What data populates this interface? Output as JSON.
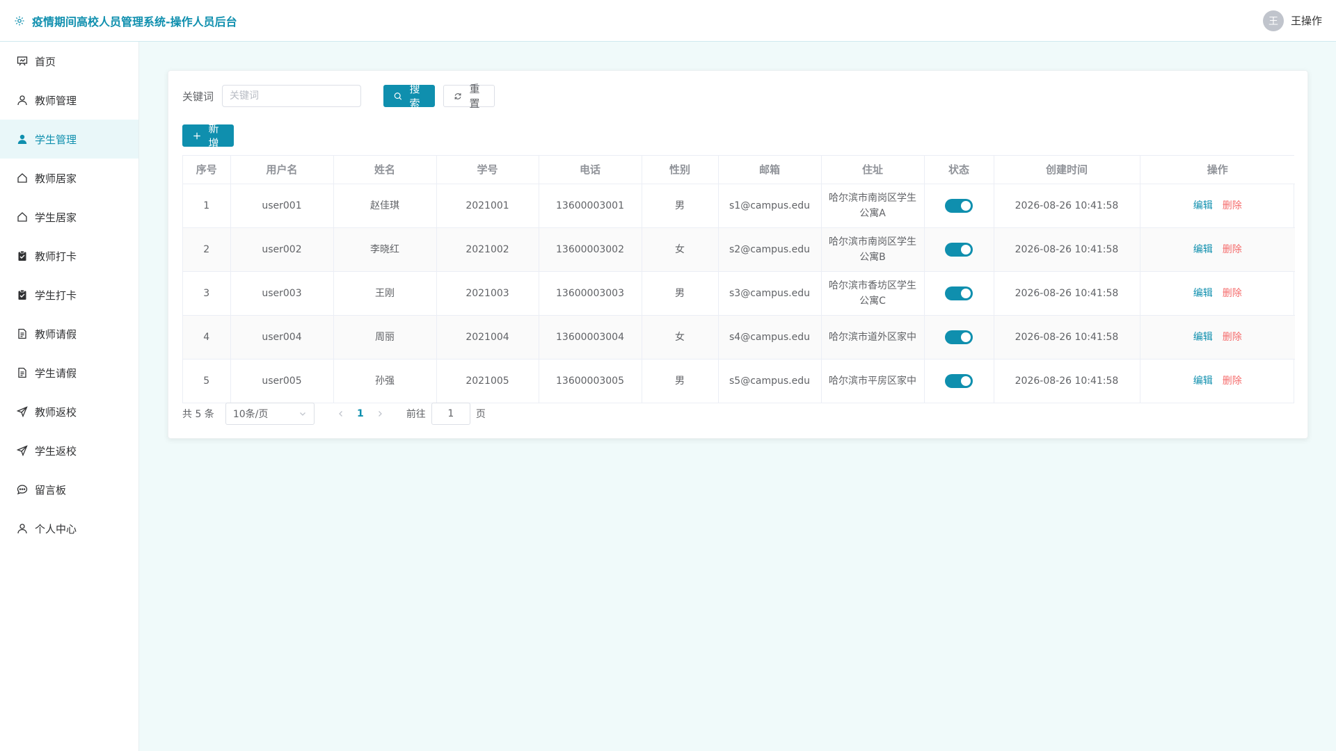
{
  "header": {
    "title": "疫情期间高校人员管理系统-操作人员后台",
    "avatar_text": "王",
    "user_name": "王操作"
  },
  "sidebar": {
    "items": [
      {
        "label": "首页",
        "icon": "dashboard-icon"
      },
      {
        "label": "教师管理",
        "icon": "user-icon"
      },
      {
        "label": "学生管理",
        "icon": "user-filled-icon",
        "active": true
      },
      {
        "label": "教师居家",
        "icon": "house-icon"
      },
      {
        "label": "学生居家",
        "icon": "house-icon"
      },
      {
        "label": "教师打卡",
        "icon": "checklist-icon"
      },
      {
        "label": "学生打卡",
        "icon": "checklist-icon"
      },
      {
        "label": "教师请假",
        "icon": "document-icon"
      },
      {
        "label": "学生请假",
        "icon": "document-icon"
      },
      {
        "label": "教师返校",
        "icon": "send-icon"
      },
      {
        "label": "学生返校",
        "icon": "send-icon"
      },
      {
        "label": "留言板",
        "icon": "chat-icon"
      },
      {
        "label": "个人中心",
        "icon": "user-icon"
      }
    ]
  },
  "search": {
    "label": "关键词",
    "placeholder": "关键词",
    "search_button": "搜索",
    "reset_button": "重置"
  },
  "toolbar": {
    "add_button": "新增"
  },
  "table": {
    "columns": [
      "序号",
      "用户名",
      "姓名",
      "学号",
      "电话",
      "性别",
      "邮箱",
      "住址",
      "状态",
      "创建时间",
      "操作"
    ],
    "rows": [
      {
        "index": "1",
        "username": "user001",
        "name": "赵佳琪",
        "student_id": "2021001",
        "phone": "13600003001",
        "gender": "男",
        "email": "s1@campus.edu",
        "address": "哈尔滨市南岗区学生公寓A",
        "status": true,
        "created": "2026-08-26 10:41:58"
      },
      {
        "index": "2",
        "username": "user002",
        "name": "李晓红",
        "student_id": "2021002",
        "phone": "13600003002",
        "gender": "女",
        "email": "s2@campus.edu",
        "address": "哈尔滨市南岗区学生公寓B",
        "status": true,
        "created": "2026-08-26 10:41:58"
      },
      {
        "index": "3",
        "username": "user003",
        "name": "王刚",
        "student_id": "2021003",
        "phone": "13600003003",
        "gender": "男",
        "email": "s3@campus.edu",
        "address": "哈尔滨市香坊区学生公寓C",
        "status": true,
        "created": "2026-08-26 10:41:58"
      },
      {
        "index": "4",
        "username": "user004",
        "name": "周丽",
        "student_id": "2021004",
        "phone": "13600003004",
        "gender": "女",
        "email": "s4@campus.edu",
        "address": "哈尔滨市道外区家中",
        "status": true,
        "created": "2026-08-26 10:41:58"
      },
      {
        "index": "5",
        "username": "user005",
        "name": "孙强",
        "student_id": "2021005",
        "phone": "13600003005",
        "gender": "男",
        "email": "s5@campus.edu",
        "address": "哈尔滨市平房区家中",
        "status": true,
        "created": "2026-08-26 10:41:58"
      }
    ],
    "actions": {
      "edit": "编辑",
      "delete": "删除"
    }
  },
  "pagination": {
    "total_text": "共 5 条",
    "page_size": "10条/页",
    "current_page": "1",
    "goto_label": "前往",
    "goto_value": "1",
    "goto_suffix": "页"
  },
  "colors": {
    "accent": "#0f8fae",
    "danger": "#f56c6c",
    "background": "#f0fafa"
  }
}
